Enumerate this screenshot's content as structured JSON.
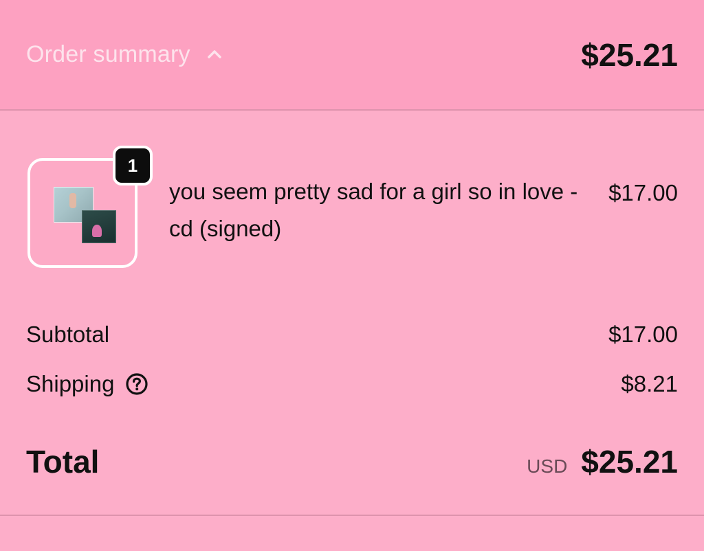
{
  "header": {
    "summary_label": "Order summary",
    "total": "$25.21",
    "chevron_icon": "chevron-up-icon"
  },
  "line_item": {
    "quantity": "1",
    "name": "you seem pretty sad for a girl so in love - cd (signed)",
    "price": "$17.00"
  },
  "costs": {
    "subtotal_label": "Subtotal",
    "subtotal_value": "$17.00",
    "shipping_label": "Shipping",
    "shipping_value": "$8.21",
    "shipping_help_icon": "question-circle-icon"
  },
  "total": {
    "label": "Total",
    "currency": "USD",
    "amount": "$25.21"
  },
  "colors": {
    "header_bg": "#fda1c1",
    "body_bg": "#fdaec9",
    "summary_label": "#fde3ec",
    "badge_bg": "#0d0d0d"
  }
}
